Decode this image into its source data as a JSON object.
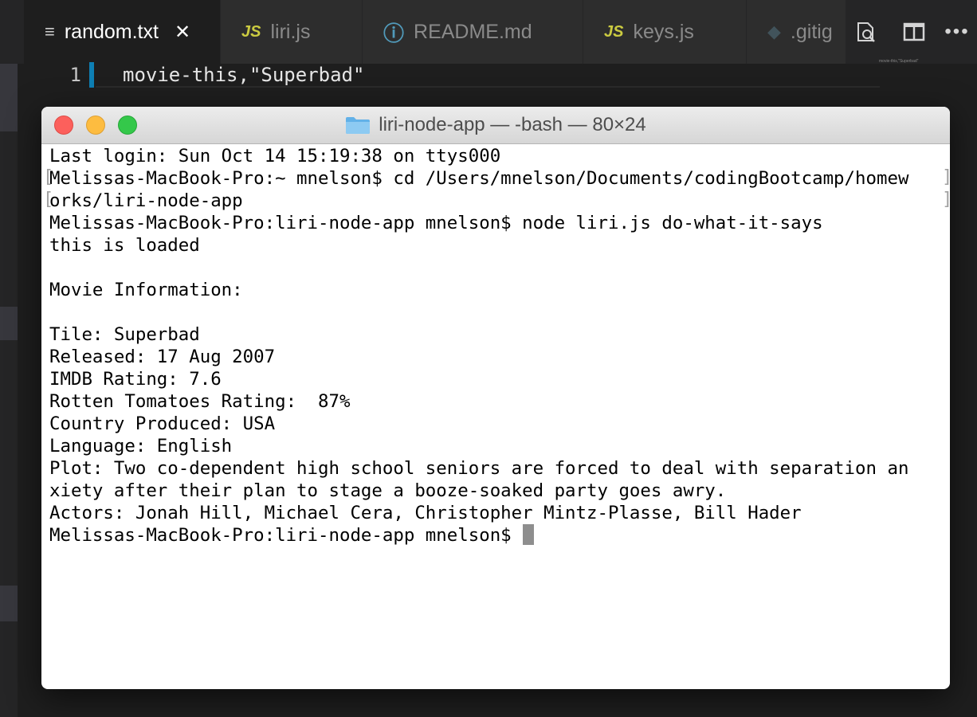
{
  "editor": {
    "tabs": [
      {
        "label": "random.txt",
        "icon": "lines-icon",
        "active": true
      },
      {
        "label": "liri.js",
        "icon_text": "JS"
      },
      {
        "label": "README.md",
        "icon_text": "ⓘ"
      },
      {
        "label": "keys.js",
        "icon_text": "JS"
      },
      {
        "label": ".gitig",
        "icon_text": "◆"
      }
    ],
    "line_number": "1",
    "code_line": "movie-this,\"Superbad\"",
    "minimap_text": "movie-this,\"Superbad\""
  },
  "terminal": {
    "title": "liri-node-app — -bash — 80×24",
    "lines": [
      "Last login: Sun Oct 14 15:19:38 on ttys000",
      "Melissas-MacBook-Pro:~ mnelson$ cd /Users/mnelson/Documents/codingBootcamp/homew",
      "orks/liri-node-app",
      "Melissas-MacBook-Pro:liri-node-app mnelson$ node liri.js do-what-it-says",
      "this is loaded",
      "",
      "Movie Information:",
      "",
      "Tile: Superbad",
      "Released: 17 Aug 2007",
      "IMDB Rating: 7.6",
      "Rotten Tomatoes Rating:  87%",
      "Country Produced: USA",
      "Language: English",
      "Plot: Two co-dependent high school seniors are forced to deal with separation an",
      "xiety after their plan to stage a booze-soaked party goes awry.",
      "Actors: Jonah Hill, Michael Cera, Christopher Mintz-Plasse, Bill Hader",
      "Melissas-MacBook-Pro:liri-node-app mnelson$"
    ]
  },
  "colors": {
    "editor_bg": "#1e1e1e",
    "tab_inactive": "#2d2d2d",
    "js_icon": "#cbcb41",
    "info_icon": "#519aba",
    "gutter_accent": "#0e7fb4",
    "close_red": "#fc605c",
    "minimize_yellow": "#fdbc40",
    "zoom_green": "#34c84a"
  }
}
